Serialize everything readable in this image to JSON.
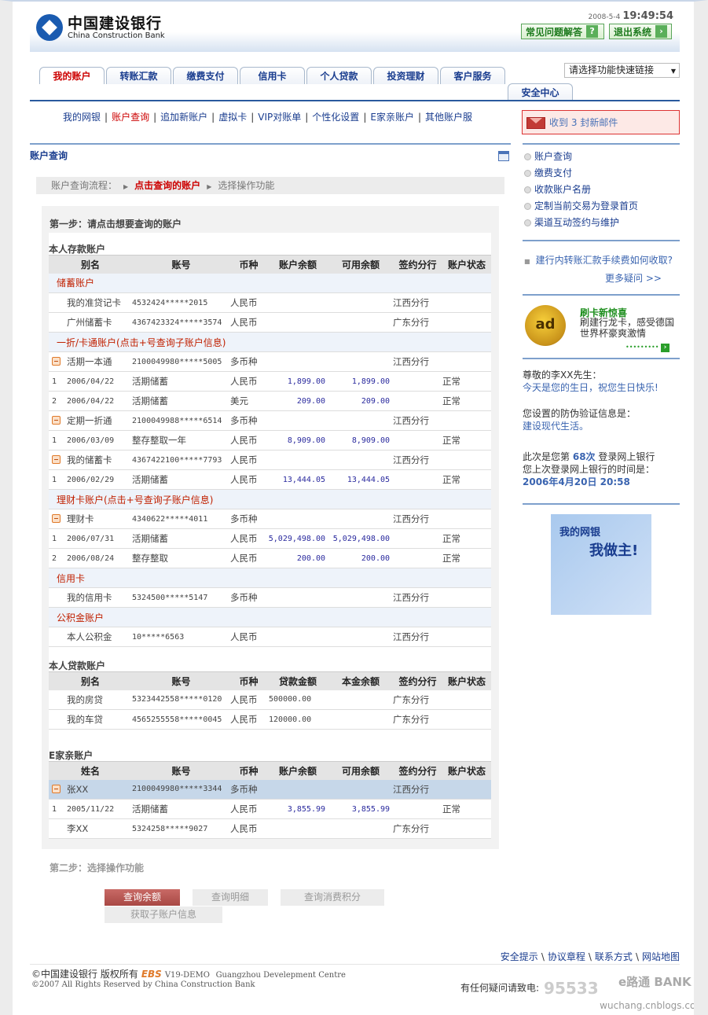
{
  "header": {
    "bank_cn": "中国建设银行",
    "bank_en": "China Construction Bank",
    "date": "2008-5-4",
    "time": "19:49:54",
    "faq_button": "常见问题解答",
    "logout_button": "退出系统"
  },
  "tabs": [
    "我的账户",
    "转账汇款",
    "缴费支付",
    "信用卡",
    "个人贷款",
    "投资理财",
    "客户服务"
  ],
  "tab_extra": "安全中心",
  "quick_link": "请选择功能快速链接",
  "subnav": [
    "我的网银",
    "账户查询",
    "追加新账户",
    "虚拟卡",
    "VIP对账单",
    "个性化设置",
    "E家亲账户",
    "其他账户服"
  ],
  "mail": {
    "prefix": "收到",
    "count": "3",
    "suffix": "封新邮件"
  },
  "section_title": "账户查询",
  "flow": {
    "label": "账户查询流程：",
    "current": "点击查询的账户",
    "next": "选择操作功能"
  },
  "step1": "第一步：请点击想要查询的账户",
  "deposit": {
    "title": "本人存款账户",
    "headers": [
      "别名",
      "账号",
      "币种",
      "账户余额",
      "可用余额",
      "签约分行",
      "账户状态"
    ],
    "rows": [
      {
        "kind": "section",
        "label": "储蓄账户"
      },
      {
        "kind": "account",
        "alias": "我的准贷记卡",
        "account": "4532424*****2015",
        "currency": "人民币",
        "branch": "江西分行"
      },
      {
        "kind": "account",
        "alias": "广州储蓄卡",
        "account": "4367423324*****3574",
        "currency": "人民币",
        "branch": "广东分行"
      },
      {
        "kind": "section",
        "label": "一折/卡通账户(点击+号查询子账户信息)"
      },
      {
        "kind": "account",
        "expand": true,
        "alias": "活期一本通",
        "account": "2100049980*****5005",
        "currency": "多币种",
        "branch": "江西分行"
      },
      {
        "kind": "sub",
        "index": "1",
        "date": "2006/04/22",
        "type": "活期储蓄",
        "currency": "人民币",
        "balance": "1,899.00",
        "available": "1,899.00",
        "status": "正常"
      },
      {
        "kind": "sub",
        "index": "2",
        "date": "2006/04/22",
        "type": "活期储蓄",
        "currency": "美元",
        "balance": "209.00",
        "available": "209.00",
        "status": "正常"
      },
      {
        "kind": "account",
        "expand": true,
        "alias": "定期一折通",
        "account": "2100049988*****6514",
        "currency": "多币种",
        "branch": "江西分行"
      },
      {
        "kind": "sub",
        "index": "1",
        "date": "2006/03/09",
        "type": "整存整取一年",
        "currency": "人民币",
        "balance": "8,909.00",
        "available": "8,909.00",
        "status": "正常"
      },
      {
        "kind": "account",
        "expand": true,
        "alias": "我的储蓄卡",
        "account": "4367422100*****7793",
        "currency": "人民币",
        "branch": "江西分行"
      },
      {
        "kind": "sub",
        "index": "1",
        "date": "2006/02/29",
        "type": "活期储蓄",
        "currency": "人民币",
        "balance": "13,444.05",
        "available": "13,444.05",
        "status": "正常"
      },
      {
        "kind": "section",
        "label": "理财卡账户(点击+号查询子账户信息)"
      },
      {
        "kind": "account",
        "expand": true,
        "alias": "理财卡",
        "account": "4340622*****4011",
        "currency": "多币种",
        "branch": "江西分行"
      },
      {
        "kind": "sub",
        "index": "1",
        "date": "2006/07/31",
        "type": "活期储蓄",
        "currency": "人民币",
        "balance": "5,029,498.00",
        "available": "5,029,498.00",
        "status": "正常"
      },
      {
        "kind": "sub",
        "index": "2",
        "date": "2006/08/24",
        "type": "整存整取",
        "currency": "人民币",
        "balance": "200.00",
        "available": "200.00",
        "status": "正常"
      },
      {
        "kind": "section",
        "label": "信用卡"
      },
      {
        "kind": "account",
        "alias": "我的信用卡",
        "account": "5324500*****5147",
        "currency": "多币种",
        "branch": "江西分行"
      },
      {
        "kind": "section",
        "label": "公积金账户"
      },
      {
        "kind": "account",
        "alias": "本人公积金",
        "account": "10*****6563",
        "currency": "人民币",
        "branch": "江西分行"
      }
    ]
  },
  "loan": {
    "title": "本人贷款账户",
    "headers": [
      "别名",
      "账号",
      "币种",
      "贷款金额",
      "本金余额",
      "签约分行",
      "账户状态"
    ],
    "rows": [
      {
        "kind": "loan",
        "alias": "我的房贷",
        "account": "5323442558*****0120",
        "currency": "人民币",
        "amount": "500000.00",
        "branch": "广东分行"
      },
      {
        "kind": "loan",
        "alias": "我的车贷",
        "account": "4565255558*****0045",
        "currency": "人民币",
        "amount": "120000.00",
        "branch": "广东分行"
      }
    ]
  },
  "family": {
    "title": "E家亲账户",
    "headers": [
      "姓名",
      "账号",
      "币种",
      "账户余额",
      "可用余额",
      "签约分行",
      "账户状态"
    ],
    "rows": [
      {
        "kind": "account",
        "expand": true,
        "highlight": true,
        "alias": "张XX",
        "account": "2100049980*****3344",
        "currency": "多币种",
        "branch": "江西分行"
      },
      {
        "kind": "sub",
        "index": "1",
        "date": "2005/11/22",
        "type": "活期储蓄",
        "currency": "人民币",
        "balance": "3,855.99",
        "available": "3,855.99",
        "status": "正常"
      },
      {
        "kind": "account",
        "alias": "李XX",
        "account": "5324258*****9027",
        "currency": "人民币",
        "branch": "广东分行"
      }
    ]
  },
  "step2": "第二步：选择操作功能",
  "actions": [
    "查询余额",
    "查询明细",
    "查询消费积分",
    "获取子账户信息"
  ],
  "sidebar": {
    "links": [
      "账户查询",
      "缴费支付",
      "收款账户名册",
      "定制当前交易为登录首页",
      "渠道互动签约与维护"
    ],
    "faq": "建行内转账汇款手续费如何收取?",
    "more": "更多疑问 >>",
    "ad_badge": "ad",
    "ad_title": "刷卡新惊喜",
    "ad_text": "刷建行龙卡，感受德国世界杯豪爽激情",
    "greeting": "尊敬的李XX先生：",
    "birthday": "今天是您的生日，祝您生日快乐!",
    "security_label": "您设置的防伪验证信息是：",
    "security_value": "建设现代生活。",
    "login_prefix": "此次是您第",
    "login_count": "68次",
    "login_suffix": "登录网上银行",
    "last_login_label": "您上次登录网上银行的时间是：",
    "last_login": "2006年4月20日  20:58",
    "promo_line1": "我的网银",
    "promo_line2": "我做主!"
  },
  "footer": {
    "links": [
      "安全提示",
      "协议章程",
      "联系方式",
      "网站地图"
    ],
    "copyright": "©中国建设银行 版权所有",
    "ebs": "EBS",
    "version": "V19-DEMO",
    "centre": "Guangzhou Develepment Centre",
    "rights": "©2007 All Rights Reserved by China Construction Bank",
    "hotline_label": "有任何疑问请致电:",
    "hotline": "95533",
    "ebank": "e路通 BANK",
    "watermark": "wuchang.cnblogs.com"
  }
}
